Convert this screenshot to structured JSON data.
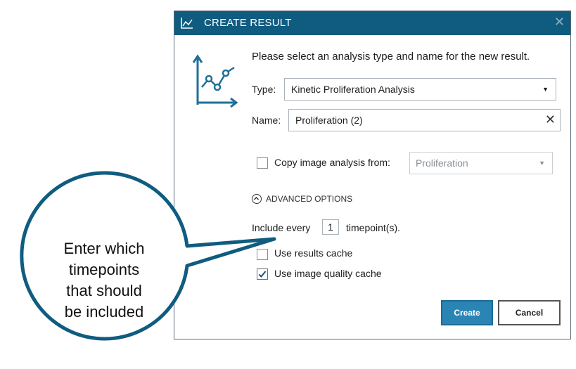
{
  "dialog": {
    "title": "CREATE RESULT",
    "close_symbol": "✕",
    "prompt": "Please select an analysis type and name for the new result.",
    "type_label": "Type:",
    "type_value": "Kinetic Proliferation Analysis",
    "name_label": "Name:",
    "name_value": "Proliferation (2)",
    "copy_label": "Copy image analysis from:",
    "copy_value": "Proliferation",
    "copy_checked": false,
    "advanced_label": "ADVANCED OPTIONS",
    "include_prefix": "Include every",
    "include_value": "1",
    "include_suffix": "timepoint(s).",
    "results_cache_label": "Use results cache",
    "results_cache_checked": false,
    "quality_cache_label": "Use image quality cache",
    "quality_cache_checked": true,
    "create_label": "Create",
    "cancel_label": "Cancel"
  },
  "callout": {
    "lines": [
      "Enter which",
      "timepoints",
      "that should",
      "be included"
    ]
  },
  "icons": {
    "title": "chart-line-icon",
    "main": "analysis-chart-icon"
  },
  "colors": {
    "titlebar": "#0f5c80",
    "accent": "#2a85b5",
    "callout_border": "#0f5c80"
  }
}
